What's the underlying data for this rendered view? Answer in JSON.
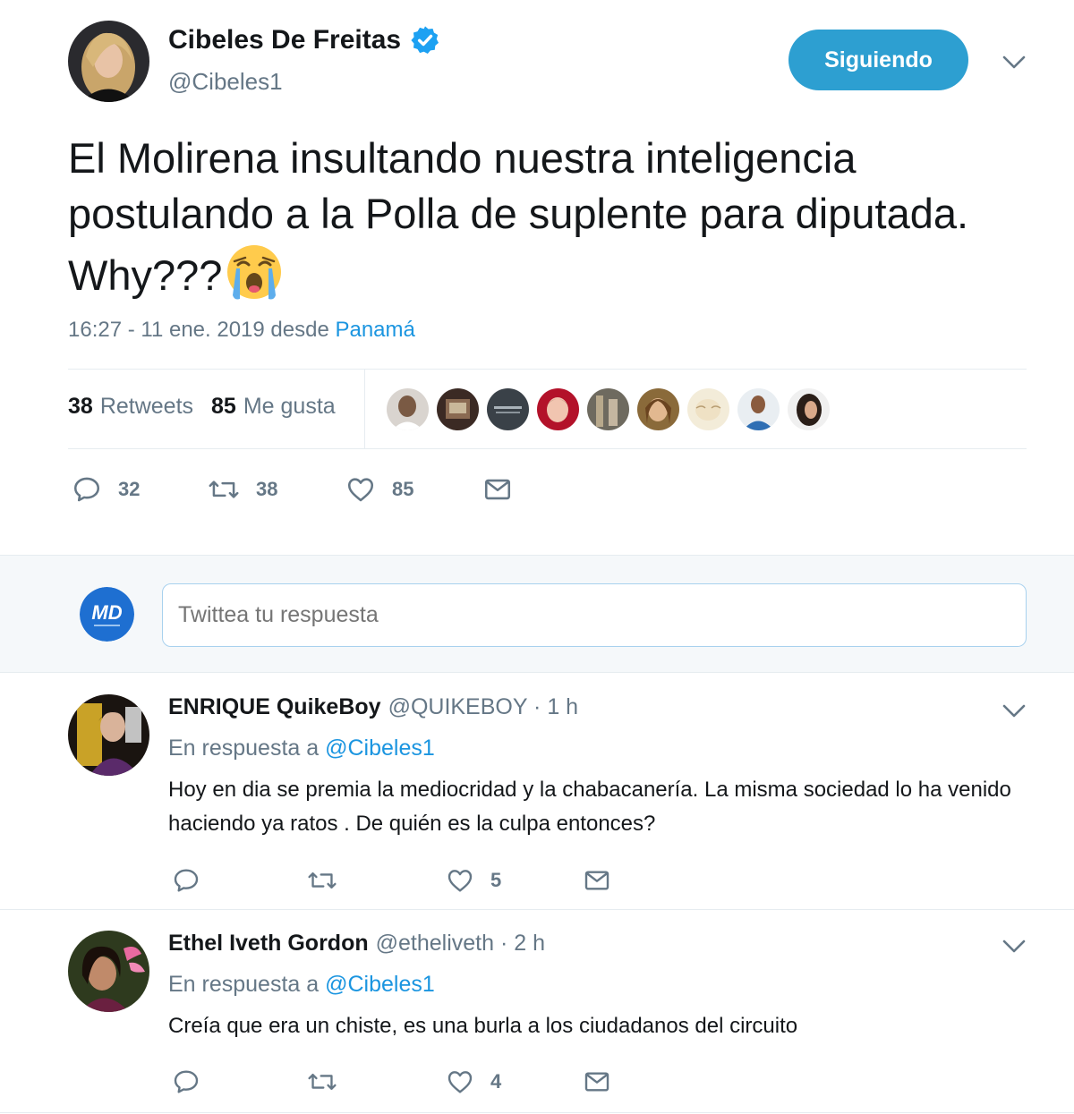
{
  "tweet": {
    "author_name": "Cibeles De Freitas",
    "author_handle": "@Cibeles1",
    "follow_label": "Siguiendo",
    "text": "El Molirena insultando nuestra inteligencia postulando a la Polla de suplente para diputada. Why???",
    "emoji": "loudly-crying-face-emoji",
    "time": "16:27 - 11 ene. 2019 desde",
    "place": "Panamá",
    "retweets_count": "38",
    "retweets_label": "Retweets",
    "likes_count": "85",
    "likes_label": "Me gusta",
    "actions": {
      "replies": "32",
      "retweets": "38",
      "likes": "85"
    }
  },
  "reply_box": {
    "avatar_text": "MD",
    "placeholder": "Twittea tu respuesta"
  },
  "replies": [
    {
      "name": "ENRIQUE QuikeBoy",
      "handle": "@QUIKEBOY",
      "time": "· 1 h",
      "in_reply_prefix": "En respuesta a",
      "in_reply_mention": "@Cibeles1",
      "text": "Hoy en dia se premia la mediocridad y la chabacanería. La misma sociedad lo ha venido haciendo ya ratos . De quién es la culpa entonces?",
      "likes": "5"
    },
    {
      "name": "Ethel Iveth Gordon",
      "handle": "@etheliveth",
      "time": "· 2 h",
      "in_reply_prefix": "En respuesta a",
      "in_reply_mention": "@Cibeles1",
      "text": "Creía que era un chiste, es una burla  a los ciudadanos del circuito",
      "likes": "4"
    }
  ],
  "colors": {
    "accent": "#1da1f2",
    "link": "#1b95e0",
    "follow_button": "#2d9fd1",
    "muted": "#657786"
  }
}
